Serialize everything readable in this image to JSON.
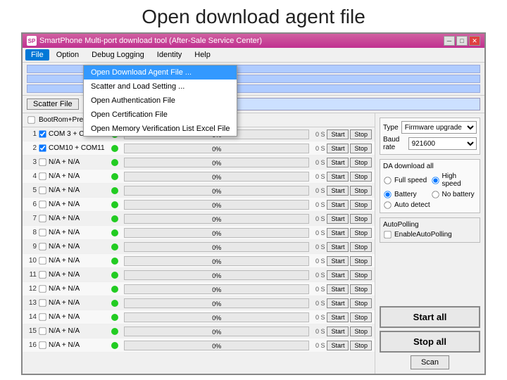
{
  "page": {
    "title": "Open download agent file"
  },
  "window": {
    "title": "SmartPhone Multi-port download tool (After-Sale Service Center)",
    "icon_text": "SP"
  },
  "menu": {
    "items": [
      "File",
      "Option",
      "Debug Logging",
      "Identity",
      "Help"
    ],
    "active": "File"
  },
  "dropdown": {
    "items": [
      "Open Download Agent File ...",
      "Scatter and Load Setting ...",
      "Open Authentication File",
      "Open Certification File",
      "Open Memory Verification List Excel File"
    ]
  },
  "scatter": {
    "label": "Scatter File",
    "btn": "Scatter File"
  },
  "ports_header": {
    "checkbox_label": "BootRom+PreLoader COM Sel All"
  },
  "ports": [
    {
      "num": 1,
      "check": true,
      "name": "COM 3 + COM 4",
      "led": true,
      "progress": 0,
      "time": "0 S"
    },
    {
      "num": 2,
      "check": true,
      "name": "COM10 + COM11",
      "led": true,
      "progress": 0,
      "time": "0 S"
    },
    {
      "num": 3,
      "check": false,
      "name": "N/A + N/A",
      "led": true,
      "progress": 0,
      "time": "0 S"
    },
    {
      "num": 4,
      "check": false,
      "name": "N/A + N/A",
      "led": true,
      "progress": 0,
      "time": "0 S"
    },
    {
      "num": 5,
      "check": false,
      "name": "N/A + N/A",
      "led": true,
      "progress": 0,
      "time": "0 S"
    },
    {
      "num": 6,
      "check": false,
      "name": "N/A + N/A",
      "led": true,
      "progress": 0,
      "time": "0 S"
    },
    {
      "num": 7,
      "check": false,
      "name": "N/A + N/A",
      "led": true,
      "progress": 0,
      "time": "0 S"
    },
    {
      "num": 8,
      "check": false,
      "name": "N/A + N/A",
      "led": true,
      "progress": 0,
      "time": "0 S"
    },
    {
      "num": 9,
      "check": false,
      "name": "N/A + N/A",
      "led": true,
      "progress": 0,
      "time": "0 S"
    },
    {
      "num": 10,
      "check": false,
      "name": "N/A + N/A",
      "led": true,
      "progress": 0,
      "time": "0 S"
    },
    {
      "num": 11,
      "check": false,
      "name": "N/A + N/A",
      "led": true,
      "progress": 0,
      "time": "0 S"
    },
    {
      "num": 12,
      "check": false,
      "name": "N/A + N/A",
      "led": true,
      "progress": 0,
      "time": "0 S"
    },
    {
      "num": 13,
      "check": false,
      "name": "N/A + N/A",
      "led": true,
      "progress": 0,
      "time": "0 S"
    },
    {
      "num": 14,
      "check": false,
      "name": "N/A + N/A",
      "led": true,
      "progress": 0,
      "time": "0 S"
    },
    {
      "num": 15,
      "check": false,
      "name": "N/A + N/A",
      "led": true,
      "progress": 0,
      "time": "0 S"
    },
    {
      "num": 16,
      "check": false,
      "name": "N/A + N/A",
      "led": true,
      "progress": 0,
      "time": "0 S"
    }
  ],
  "port_btns": {
    "start": "Start",
    "stop": "Stop"
  },
  "right_panel": {
    "type_label": "Type",
    "type_value": "Firmware upgrade",
    "baud_label": "Baud rate",
    "baud_value": "921600",
    "da_title": "DA download all",
    "da_options": [
      "Full speed",
      "High speed"
    ],
    "da_selected": "High speed",
    "battery_options": [
      "Battery",
      "No battery"
    ],
    "battery_selected": "Battery",
    "auto_detect": "Auto detect",
    "auto_polling_label": "AutoPolling",
    "enable_auto_polling": "EnableAutoPolling",
    "start_all": "Start all",
    "stop_all": "Stop all",
    "scan": "Scan"
  }
}
